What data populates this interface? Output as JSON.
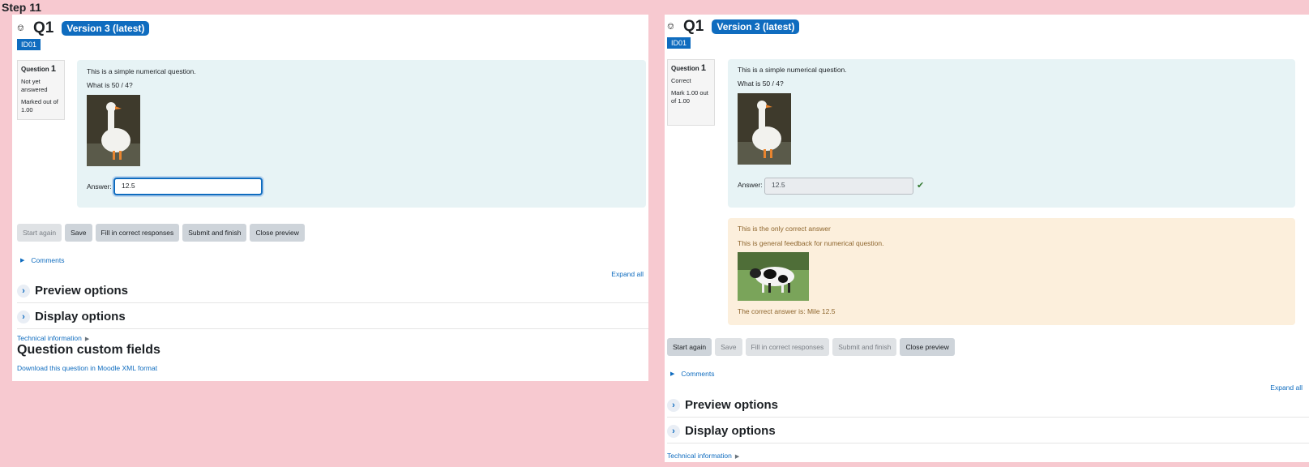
{
  "step_label": "Step 11",
  "left": {
    "header": {
      "pin_icon": "pin-icon",
      "qname": "Q1",
      "version": "Version 3 (latest)",
      "id_badge": "ID01"
    },
    "info": {
      "question_label": "Question",
      "question_number": "1",
      "state": "Not yet answered",
      "mark": "Marked out of 1.00"
    },
    "question": {
      "text": "This is a simple numerical question.",
      "prompt": "What is 50 / 4?",
      "answer_label": "Answer:",
      "answer_value": "12.5"
    },
    "buttons": [
      {
        "label": "Start again",
        "disabled": true
      },
      {
        "label": "Save",
        "disabled": false
      },
      {
        "label": "Fill in correct responses",
        "disabled": false
      },
      {
        "label": "Submit and finish",
        "disabled": false
      },
      {
        "label": "Close preview",
        "disabled": false
      }
    ],
    "comments": "Comments",
    "expand_all": "Expand all",
    "sections": [
      "Preview options",
      "Display options"
    ],
    "technical_info": "Technical information",
    "custom_fields_title": "Question custom fields",
    "download_link": "Download this question in Moodle XML format"
  },
  "right": {
    "header": {
      "pin_icon": "pin-icon",
      "qname": "Q1",
      "version": "Version 3 (latest)",
      "id_badge": "ID01"
    },
    "info": {
      "question_label": "Question",
      "question_number": "1",
      "state": "Correct",
      "mark": "Mark 1.00 out of 1.00"
    },
    "question": {
      "text": "This is a simple numerical question.",
      "prompt": "What is 50 / 4?",
      "answer_label": "Answer:",
      "answer_value": "12.5",
      "correct_icon": "check-icon"
    },
    "feedback": {
      "specific": "This is the only correct answer",
      "general": "This is general feedback for numerical question.",
      "right_answer": "The correct answer is: Mile 12.5"
    },
    "buttons": [
      {
        "label": "Start again",
        "disabled": false
      },
      {
        "label": "Save",
        "disabled": true
      },
      {
        "label": "Fill in correct responses",
        "disabled": true
      },
      {
        "label": "Submit and finish",
        "disabled": true
      },
      {
        "label": "Close preview",
        "disabled": false
      }
    ],
    "comments": "Comments",
    "expand_all": "Expand all",
    "sections": [
      "Preview options",
      "Display options"
    ],
    "technical_info": "Technical information"
  },
  "colors": {
    "background": "#f7c9d0",
    "brand": "#0f6cbf",
    "formulation_bg": "#e7f3f5",
    "feedback_bg": "#fcefdc",
    "correct": "#357a32"
  }
}
